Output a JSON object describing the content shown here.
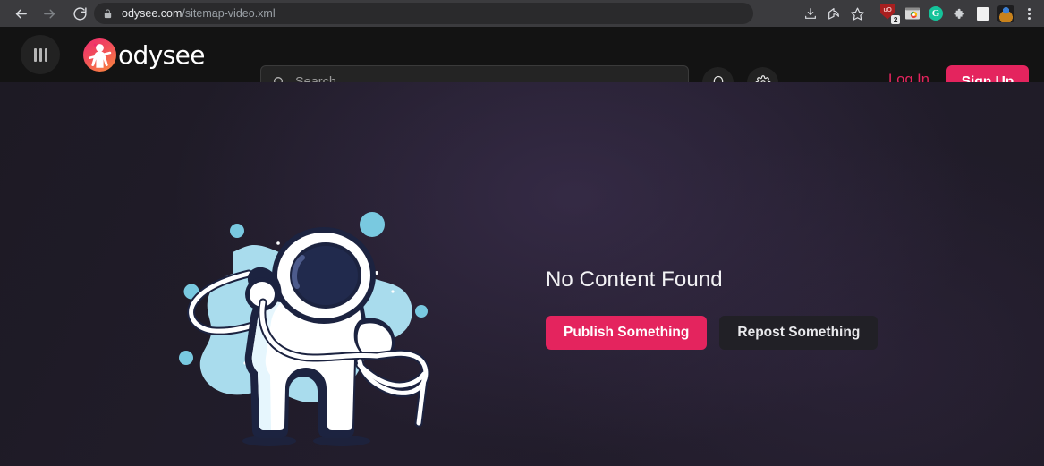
{
  "browser": {
    "back_icon": "back-arrow-icon",
    "forward_icon": "forward-arrow-icon",
    "reload_icon": "reload-icon",
    "lock_icon": "lock-icon",
    "url_host": "odysee.com",
    "url_path": "/sitemap-video.xml",
    "actions": {
      "install_icon": "install-app-icon",
      "share_icon": "share-icon",
      "bookmark_icon": "star-bookmark-icon",
      "ublock_label": "uO",
      "ublock_badge": "2",
      "photo_ext_icon": "photo-extension-icon",
      "grammarly_label": "G",
      "extensions_icon": "puzzle-extensions-icon",
      "reading_list_icon": "reading-list-icon",
      "avatar_icon": "profile-avatar-icon",
      "menu_icon": "three-dot-menu-icon"
    }
  },
  "header": {
    "menu_icon": "hamburger-menu-icon",
    "logo_icon": "odysee-astronaut-logo-icon",
    "brand": "odysee",
    "search": {
      "icon": "search-icon",
      "placeholder": "Search",
      "value": ""
    },
    "notifications_icon": "bell-icon",
    "settings_icon": "gear-icon",
    "login_label": "Log In",
    "signup_label": "Sign Up"
  },
  "main": {
    "illustration_icon": "astronaut-lasso-illustration",
    "title": "No Content Found",
    "publish_label": "Publish Something",
    "repost_label": "Repost Something"
  },
  "colors": {
    "accent_pink": "#e4245e",
    "header_bg": "#131313",
    "page_bg": "#211b2a",
    "illustration_blue": "#a9dced",
    "visor_navy": "#1c2340"
  }
}
